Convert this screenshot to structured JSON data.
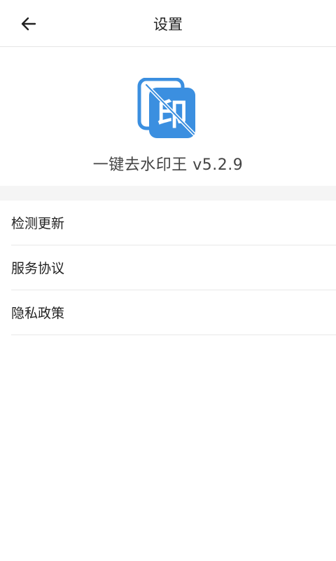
{
  "header": {
    "title": "设置",
    "back_icon": "arrow-left-icon"
  },
  "app": {
    "logo_icon": "watermark-stamp-icon",
    "logo_char": "印",
    "name_version": "一键去水印王 v5.2.9",
    "logo_color": "#3b8fe0"
  },
  "menu": {
    "items": [
      {
        "label": "检测更新"
      },
      {
        "label": "服务协议"
      },
      {
        "label": "隐私政策"
      }
    ]
  }
}
